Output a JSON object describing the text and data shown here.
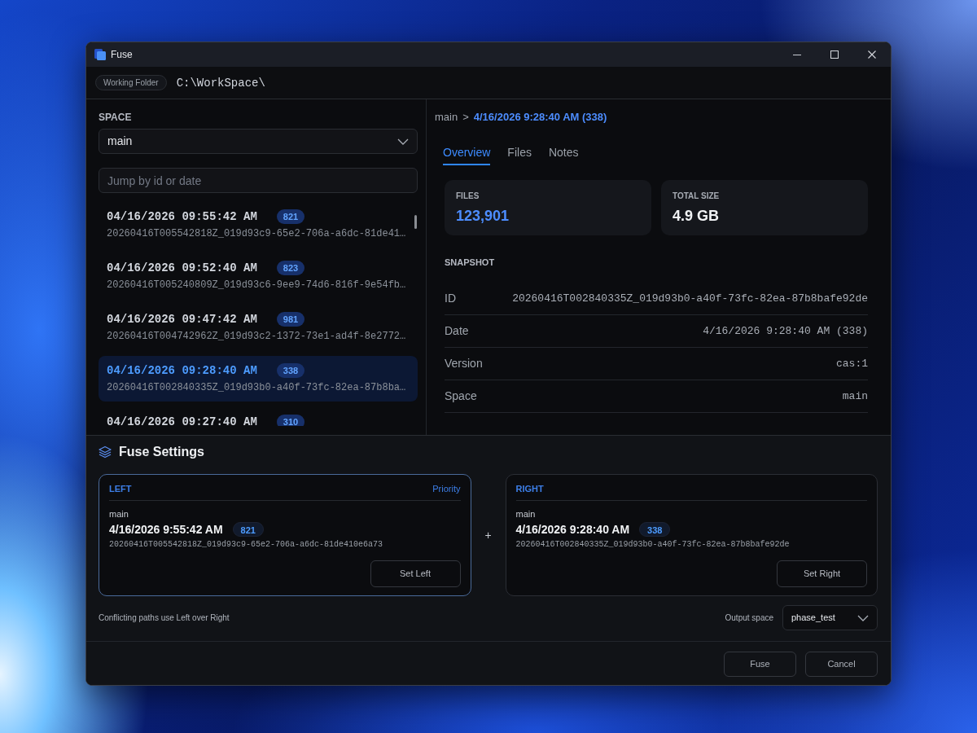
{
  "window": {
    "title": "Fuse"
  },
  "working_folder": {
    "label": "Working Folder",
    "path": "C:\\WorkSpace\\"
  },
  "space": {
    "label": "SPACE",
    "value": "main"
  },
  "search": {
    "placeholder": "Jump by id or date"
  },
  "snapshots": [
    {
      "date": "04/16/2026 09:55:42 AM",
      "count": "821",
      "id": "20260416T005542818Z_019d93c9-65e2-706a-a6dc-81de41…",
      "selected": false
    },
    {
      "date": "04/16/2026 09:52:40 AM",
      "count": "823",
      "id": "20260416T005240809Z_019d93c6-9ee9-74d6-816f-9e54fb…",
      "selected": false
    },
    {
      "date": "04/16/2026 09:47:42 AM",
      "count": "981",
      "id": "20260416T004742962Z_019d93c2-1372-73e1-ad4f-8e2772…",
      "selected": false
    },
    {
      "date": "04/16/2026 09:28:40 AM",
      "count": "338",
      "id": "20260416T002840335Z_019d93b0-a40f-73fc-82ea-87b8ba…",
      "selected": true
    },
    {
      "date": "04/16/2026 09:27:40 AM",
      "count": "310",
      "selected": false
    }
  ],
  "breadcrumb": {
    "space": "main",
    "separator": ">",
    "current": "4/16/2026 9:28:40 AM (338)"
  },
  "tabs": [
    {
      "label": "Overview",
      "selected": true
    },
    {
      "label": "Files",
      "selected": false
    },
    {
      "label": "Notes",
      "selected": false
    }
  ],
  "stats": [
    {
      "label": "FILES",
      "value": "123,901",
      "highlight": true
    },
    {
      "label": "TOTAL SIZE",
      "value": "4.9 GB",
      "highlight": false
    }
  ],
  "snapshot": {
    "heading": "SNAPSHOT",
    "rows": [
      {
        "label": "ID",
        "value": "20260416T002840335Z_019d93b0-a40f-73fc-82ea-87b8bafe92de"
      },
      {
        "label": "Date",
        "value": "4/16/2026 9:28:40 AM (338)"
      },
      {
        "label": "Version",
        "value": "cas:1"
      },
      {
        "label": "Space",
        "value": "main"
      }
    ]
  },
  "fuse_settings": {
    "title": "Fuse Settings",
    "sides": [
      {
        "heading": "LEFT",
        "priority": true,
        "priority_label": "Priority",
        "space": "main",
        "date": "4/16/2026 9:55:42 AM",
        "count": "821",
        "id": "20260416T005542818Z_019d93c9-65e2-706a-a6dc-81de410e6a73",
        "button": "Set Left"
      },
      {
        "heading": "RIGHT",
        "priority": false,
        "space": "main",
        "date": "4/16/2026 9:28:40 AM",
        "count": "338",
        "id": "20260416T002840335Z_019d93b0-a40f-73fc-82ea-87b8bafe92de",
        "button": "Set Right"
      }
    ],
    "joiner": "+",
    "note": "Conflicting paths use Left over Right",
    "output": {
      "label": "Output space",
      "value": "phase_test"
    }
  },
  "buttons": [
    "Fuse",
    "Cancel"
  ]
}
